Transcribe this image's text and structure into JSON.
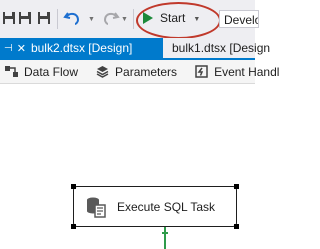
{
  "toolbar": {
    "start_label": "Start",
    "config_value": "Developm",
    "icons": [
      "save-icon",
      "save-all-icon",
      "save-as-icon",
      "undo-icon",
      "redo-icon",
      "play-icon"
    ],
    "highlight_color": "#c0392b"
  },
  "tabs": [
    {
      "label": "bulk2.dtsx [Design]",
      "active": true
    },
    {
      "label": "bulk1.dtsx [Design",
      "active": false
    }
  ],
  "designer_tabs": [
    {
      "label": "Data Flow",
      "icon": "data-flow-icon"
    },
    {
      "label": "Parameters",
      "icon": "parameters-icon"
    },
    {
      "label": "Event Handl",
      "icon": "event-handlers-icon"
    }
  ],
  "canvas": {
    "task": {
      "label": "Execute SQL Task",
      "icon": "sql-task-icon"
    },
    "connector_color": "#2e9b4a"
  },
  "colors": {
    "accent": "#007acc",
    "run_green": "#1c8a3a"
  }
}
